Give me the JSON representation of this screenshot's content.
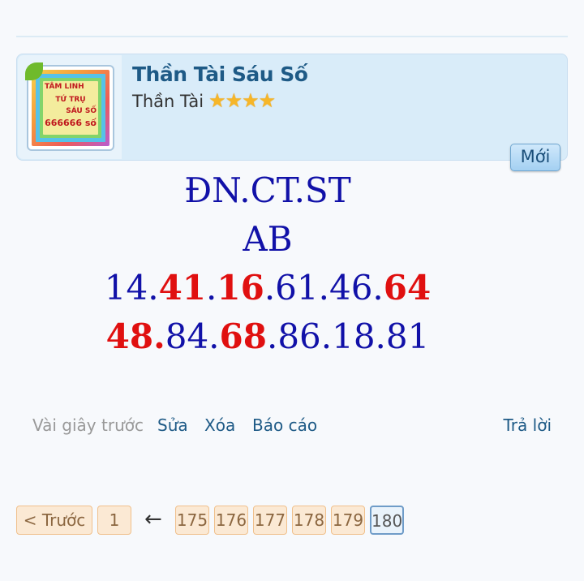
{
  "post": {
    "poster_name": "Thần Tài Sáu Số",
    "rank_label": "Thần Tài",
    "stars": 4,
    "new_badge": "Mới",
    "avatar_text": [
      "TÂM LINH",
      "TỨ TRỤ",
      "SÁU SỐ",
      "666666 số"
    ]
  },
  "body": {
    "line1": "ĐN.CT.ST",
    "line2": "AB",
    "line3": [
      {
        "text": "14.",
        "color": "blue"
      },
      {
        "text": "41",
        "color": "red"
      },
      {
        "text": ".",
        "color": "blue"
      },
      {
        "text": "16",
        "color": "red"
      },
      {
        "text": ".61.46.",
        "color": "blue"
      },
      {
        "text": "64",
        "color": "red"
      }
    ],
    "line4": [
      {
        "text": "48.",
        "color": "red"
      },
      {
        "text": "84.",
        "color": "blue"
      },
      {
        "text": "68",
        "color": "red"
      },
      {
        "text": ".86.18.81",
        "color": "blue"
      }
    ]
  },
  "meta": {
    "time": "Vài giây trước",
    "edit": "Sửa",
    "delete": "Xóa",
    "report": "Báo cáo",
    "reply": "Trả lời"
  },
  "pager": {
    "prev": "< Trước",
    "first": "1",
    "ellipsis_arrow": "←",
    "pages": [
      "175",
      "176",
      "177",
      "178",
      "179"
    ],
    "current": "180"
  },
  "colors": {
    "header_bg": "#d9ecf9",
    "name_color": "#1e5a86",
    "text_blue": "#1111a8",
    "text_red": "#e01010"
  }
}
